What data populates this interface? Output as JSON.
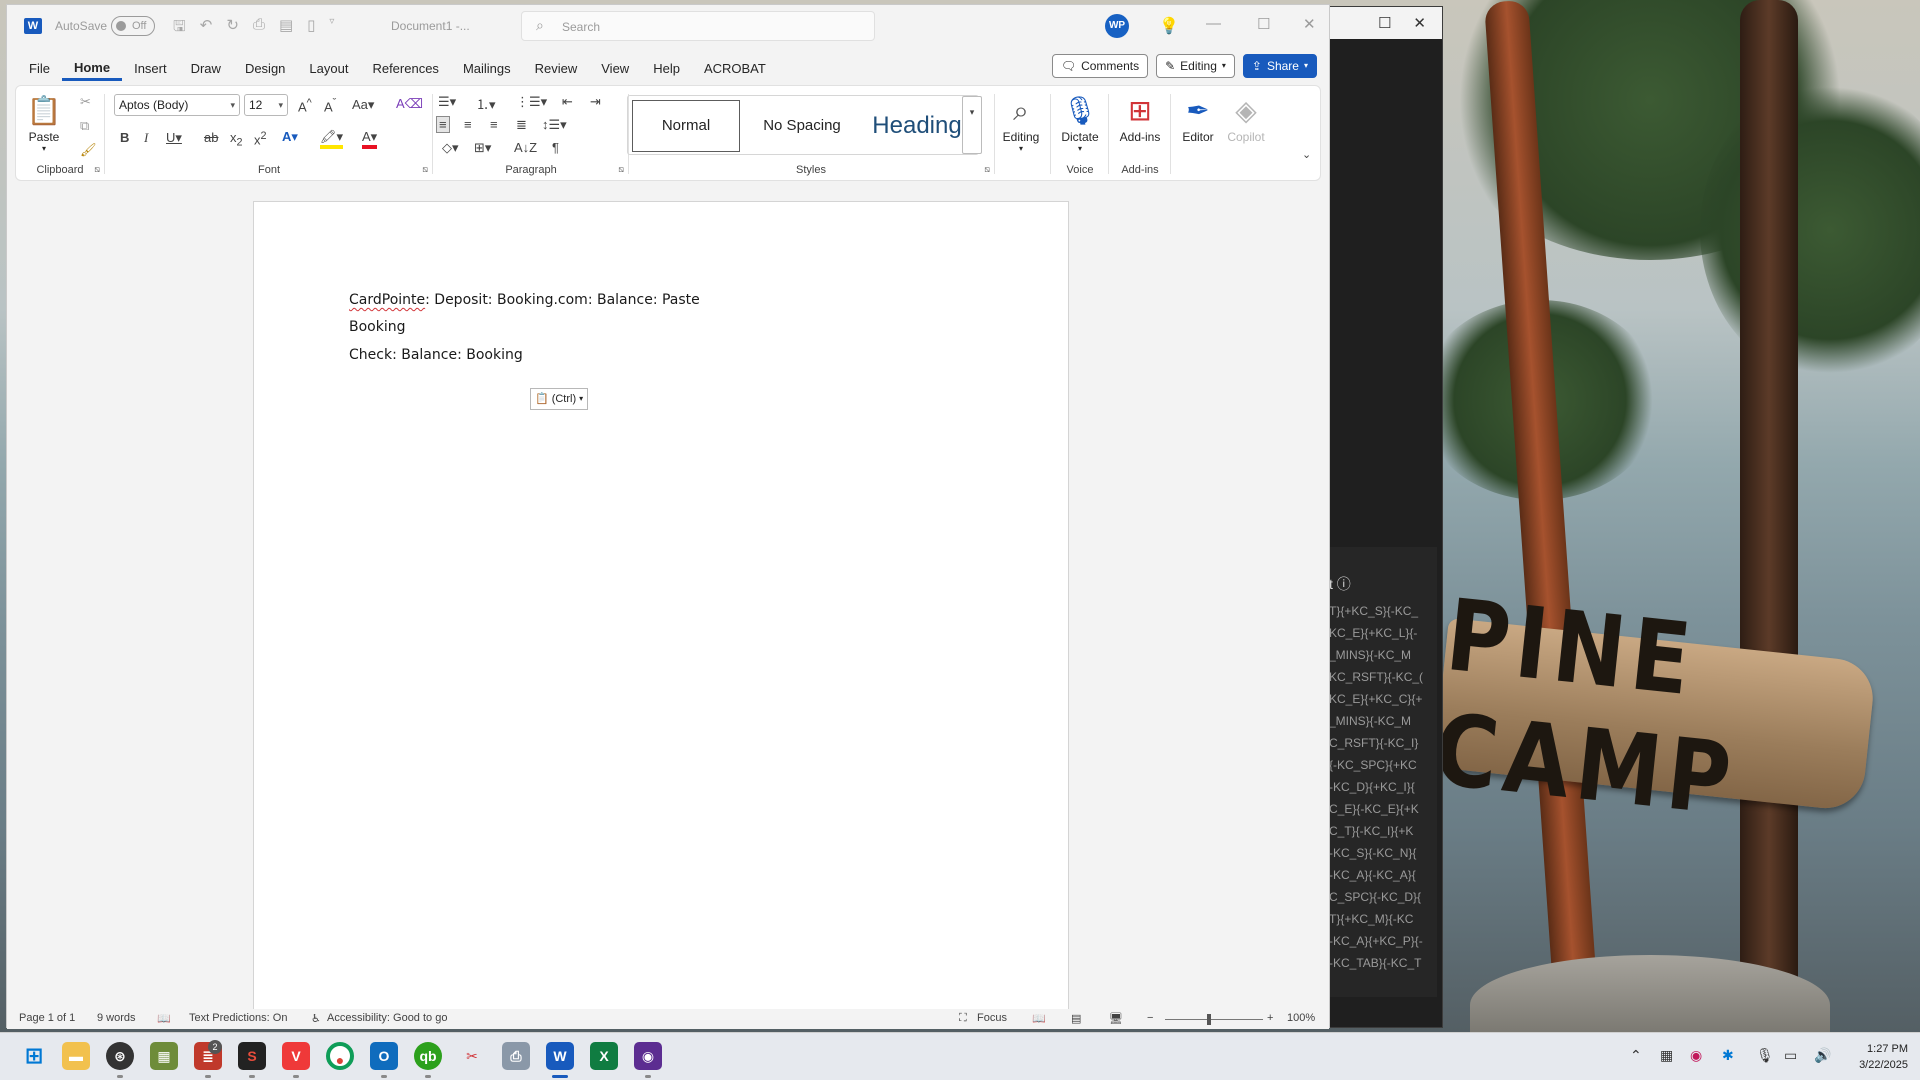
{
  "window": {
    "app_letter": "W",
    "autosave_label": "AutoSave",
    "autosave_state": "Off",
    "doc_title": "Document1 -...",
    "search_placeholder": "Search",
    "avatar_initials": "WP"
  },
  "menu": {
    "tabs": [
      "File",
      "Home",
      "Insert",
      "Draw",
      "Design",
      "Layout",
      "References",
      "Mailings",
      "Review",
      "View",
      "Help",
      "ACROBAT"
    ],
    "active": "Home",
    "comments": "Comments",
    "editing": "Editing",
    "share": "Share"
  },
  "ribbon": {
    "clipboard": {
      "paste": "Paste",
      "label": "Clipboard"
    },
    "font": {
      "name": "Aptos (Body)",
      "size": "12",
      "label": "Font"
    },
    "paragraph": {
      "label": "Paragraph"
    },
    "styles": {
      "normal": "Normal",
      "no_spacing": "No Spacing",
      "heading": "Heading",
      "label": "Styles"
    },
    "editing": {
      "label": "Editing"
    },
    "voice": {
      "dictate": "Dictate",
      "label": "Voice"
    },
    "addins": {
      "button": "Add-ins",
      "label": "Add-ins"
    },
    "editor": "Editor",
    "copilot": "Copilot"
  },
  "document": {
    "lines": [
      {
        "misspelled": "CardPointe",
        "rest": ": Deposit: Booking.com: Balance: Paste"
      },
      {
        "text": "Booking"
      },
      {
        "text": "Check: Balance: Booking"
      }
    ],
    "paste_options": "(Ctrl)"
  },
  "statusbar": {
    "page": "Page 1 of 1",
    "words": "9 words",
    "predictions": "Text Predictions: On",
    "accessibility": "Accessibility: Good to go",
    "focus": "Focus",
    "zoom": "100%"
  },
  "background_window": {
    "header": "t",
    "lines": [
      "T}{+KC_S}{-KC_",
      "KC_E}{+KC_L}{-",
      "_MINS}{-KC_M",
      "KC_RSFT}{-KC_(",
      "KC_E}{+KC_C}{+",
      "_MINS}{-KC_M",
      "C_RSFT}{-KC_I}",
      "{-KC_SPC}{+KC",
      "-KC_D}{+KC_I}{",
      "C_E}{-KC_E}{+K",
      "C_T}{-KC_I}{+K",
      "-KC_S}{-KC_N}{",
      "-KC_A}{-KC_A}{",
      "C_SPC}{-KC_D}{",
      "T}{+KC_M}{-KC",
      "-KC_A}{+KC_P}{-",
      "-KC_TAB}{-KC_T"
    ]
  },
  "photo": {
    "sign_text": "PINE CAMP"
  },
  "taskbar": {
    "badge_count": "2",
    "time": "1:27 PM",
    "date": "3/22/2025"
  }
}
